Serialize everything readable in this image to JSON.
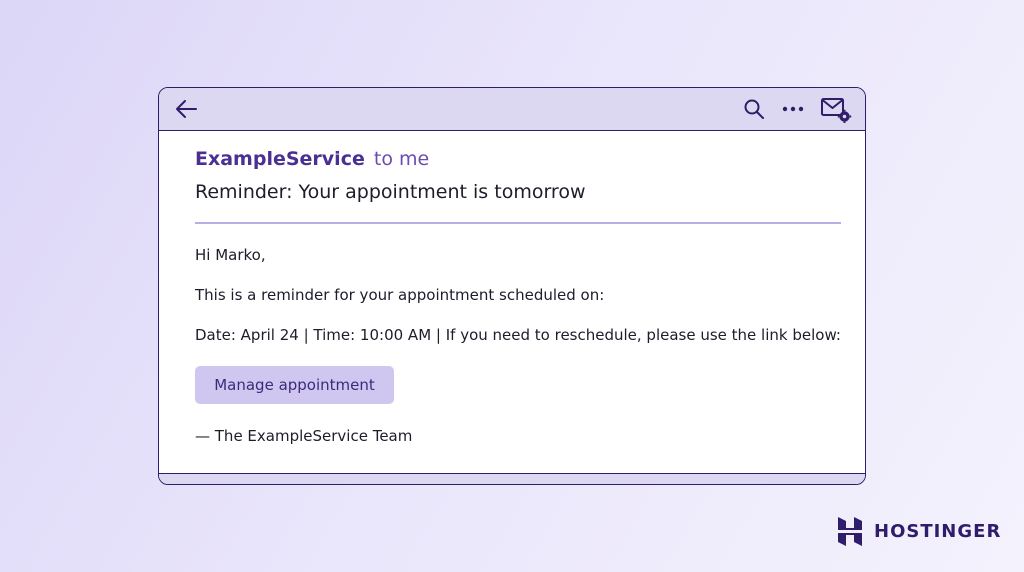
{
  "email": {
    "sender": "ExampleService",
    "recipient": "to me",
    "subject": "Reminder: Your appointment is tomorrow",
    "greeting": "Hi Marko,",
    "intro": "This is a reminder for your appointment scheduled on:",
    "details": "Date: April 24 | Time: 10:00 AM | If you need to reschedule, please use the link below:",
    "button_label": "Manage appointment",
    "signature": "— The ExampleService Team"
  },
  "toolbar": {
    "icons": [
      "back-arrow-icon",
      "search-icon",
      "more-options-icon",
      "mail-settings-icon"
    ]
  },
  "brand": {
    "name": "HOSTINGER"
  },
  "colors": {
    "accent": "#4b2f92",
    "border": "#2f1c6a",
    "toolbar_bg": "#dcd8f1",
    "button_bg": "#cfc7f0",
    "divider": "#b8aee6"
  }
}
